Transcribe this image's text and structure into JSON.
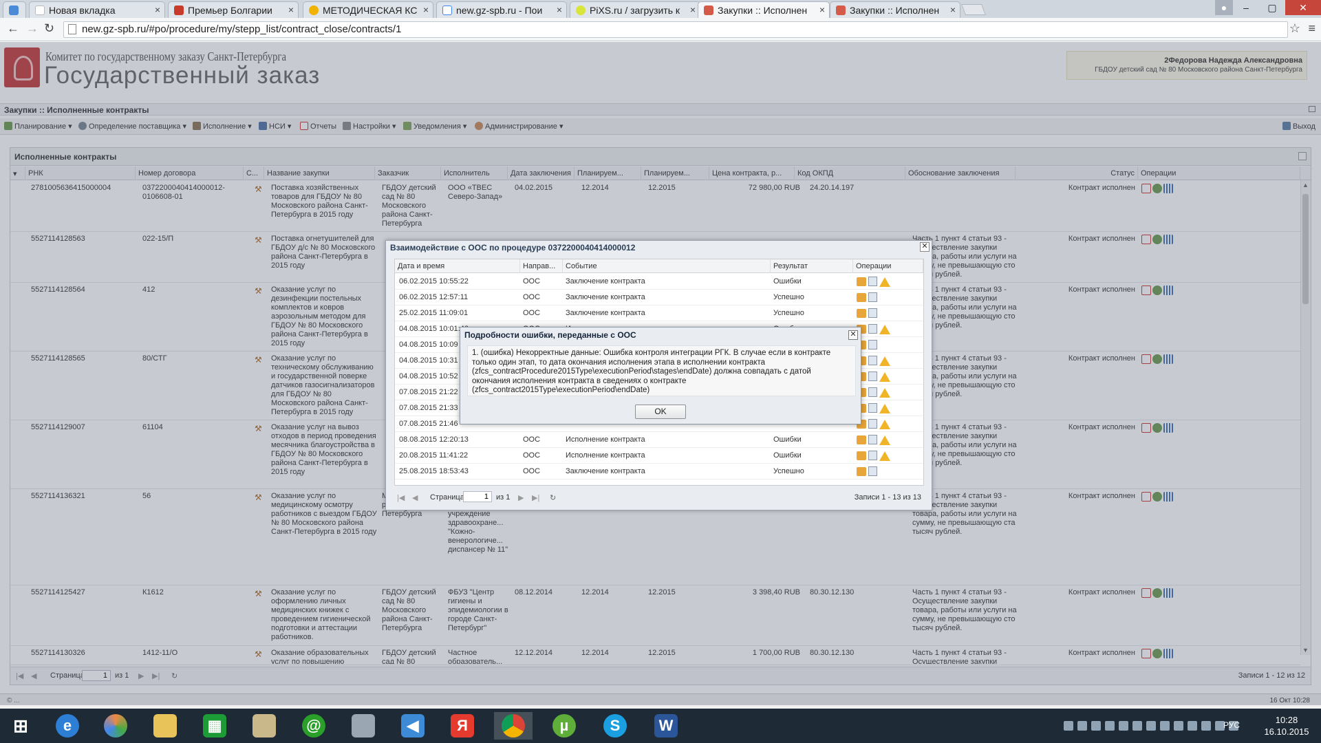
{
  "browser": {
    "tabs": [
      {
        "title": "",
        "close": ""
      },
      {
        "title": "Новая вкладка",
        "close": "×"
      },
      {
        "title": "Премьер Болгарии",
        "close": "×"
      },
      {
        "title": "МЕТОДИЧЕСКАЯ КС",
        "close": "×"
      },
      {
        "title": "new.gz-spb.ru - Пои",
        "close": "×"
      },
      {
        "title": "PiXS.ru / загрузить к",
        "close": "×"
      },
      {
        "title": "Закупки :: Исполнен",
        "close": "×"
      },
      {
        "title": "Закупки :: Исполнен",
        "close": "×"
      }
    ],
    "url": "new.gz-spb.ru/#po/procedure/my/stepp_list/contract_close/contracts/1"
  },
  "header": {
    "org_line1": "Комитет по государственному заказу Санкт-Петербурга",
    "org_line2": "Государственный заказ",
    "user_name": "2Федорова Надежда Александровна",
    "user_org": "ГБДОУ детский сад № 80 Московского района Санкт-Петербурга"
  },
  "breadcrumb": "Закупки :: Исполненные контракты",
  "toolbar": {
    "items": [
      "Планирование ▾",
      "Определение поставщика ▾",
      "Исполнение ▾",
      "НСИ ▾",
      "Отчеты",
      "Настройки ▾",
      "Уведомления ▾",
      "Администрирование ▾"
    ],
    "exit": "Выход"
  },
  "grid": {
    "title": "Исполненные контракты",
    "columns": [
      "РНК",
      "Номер договора",
      "С...",
      "Название закупки",
      "Заказчик",
      "Исполнитель",
      "Дата заключения",
      "Планируем...",
      "Планируем...",
      "Цена контракта, р...",
      "Код ОКПД",
      "Обоснование заключения",
      "Статус",
      "Операции"
    ],
    "rows": [
      {
        "rnk": "2781005636415000004",
        "num": "0372200040414000012-0106608-01",
        "name": "Поставка хозяйственных товаров для ГБДОУ № 80 Московского района Санкт-Петербурга в 2015 году",
        "customer": "ГБДОУ детский сад № 80 Московского района Санкт-Петербурга",
        "executor": "ООО «ТВЕС Северо-Запад»",
        "date": "04.02.2015",
        "plan1": "12.2014",
        "plan2": "12.2015",
        "price": "72 980,00 RUB",
        "okpd": "24.20.14.197",
        "reason": "",
        "status": "Контракт исполнен"
      },
      {
        "rnk": "5527114128563",
        "num": "022-15/П",
        "name": "Поставка огнетушителей для ГБДОУ д/с № 80 Московского района Санкт-Петербурга в 2015 году",
        "customer": "",
        "executor": "",
        "date": "",
        "plan1": "",
        "plan2": "",
        "price": "",
        "okpd": "",
        "reason": "Часть 1 пункт 4 статьи 93 - Осуществление закупки товара, работы или услуги на сумму, не превышающую сто тысяч рублей.",
        "status": "Контракт исполнен"
      },
      {
        "rnk": "5527114128564",
        "num": "412",
        "name": "Оказание услуг по дезинфекции постельных комплектов и ковров аэрозольным методом для ГБДОУ № 80 Московского района Санкт-Петербурга в 2015 году",
        "customer": "",
        "executor": "",
        "date": "",
        "plan1": "",
        "plan2": "",
        "price": "",
        "okpd": "",
        "reason": "Часть 1 пункт 4 статьи 93 - Осуществление закупки товара, работы или услуги на сумму, не превышающую сто тысяч рублей.",
        "status": "Контракт исполнен"
      },
      {
        "rnk": "5527114128565",
        "num": "80/СТГ",
        "name": "Оказание услуг по техническому обслуживанию и государственной поверке датчиков газосигнализаторов для ГБДОУ № 80 Московского района Санкт-Петербурга в 2015 году",
        "customer": "",
        "executor": "",
        "date": "",
        "plan1": "",
        "plan2": "",
        "price": "",
        "okpd": "",
        "reason": "Часть 1 пункт 4 статьи 93 - Осуществление закупки товара, работы или услуги на сумму, не превышающую сто тысяч рублей.",
        "status": "Контракт исполнен"
      },
      {
        "rnk": "5527114129007",
        "num": "61104",
        "name": "Оказание услуг на вывоз отходов в период проведения месячника благоустройства в ГБДОУ № 80 Московского района Санкт-Петербурга в 2015 году",
        "customer": "",
        "executor": "",
        "date": "",
        "plan1": "",
        "plan2": "",
        "price": "",
        "okpd": "",
        "reason": "Часть 1 пункт 4 статьи 93 - Осуществление закупки товара, работы или услуги на сумму, не превышающую сто тысяч рублей.",
        "status": "Контракт исполнен"
      },
      {
        "rnk": "5527114136321",
        "num": "56",
        "name": "Оказание услуг по медицинскому осмотру работников с выездом ГБДОУ № 80 Московского района Санкт-Петербурга в 2015 году",
        "customer": "Московского района Санкт-Петербурга",
        "executor": "государственное бюджетное учреждение здравоохране... \"Кожно-венерологиче... диспансер № 11\"",
        "date": "",
        "plan1": "",
        "plan2": "",
        "price": "",
        "okpd": "",
        "reason": "Часть 1 пункт 4 статьи 93 - Осуществление закупки товара, работы или услуги на сумму, не превышающую ста тысяч рублей.",
        "status": "Контракт исполнен"
      },
      {
        "rnk": "5527114125427",
        "num": "К1612",
        "name": "Оказание услуг по оформлению личных медицинских книжек с проведением гигиенической подготовки и аттестации работников.",
        "customer": "ГБДОУ детский сад № 80 Московского района Санкт-Петербурга",
        "executor": "ФБУЗ \"Центр гигиены и эпидемиологии в городе Санкт-Петербург\"",
        "date": "08.12.2014",
        "plan1": "12.2014",
        "plan2": "12.2015",
        "price": "3 398,40 RUB",
        "okpd": "80.30.12.130",
        "reason": "Часть 1 пункт 4 статьи 93 - Осуществление закупки товара, работы или услуги на сумму, не превышающую сто тысяч рублей.",
        "status": "Контракт исполнен"
      },
      {
        "rnk": "5527114130326",
        "num": "1412-11/О",
        "name": "Оказание образовательных услуг по повышению",
        "customer": "ГБДОУ детский сад № 80",
        "executor": "Частное образователь...",
        "date": "12.12.2014",
        "plan1": "12.2014",
        "plan2": "12.2015",
        "price": "1 700,00 RUB",
        "okpd": "80.30.12.130",
        "reason": "Часть 1 пункт 4 статьи 93 - Осуществление закупки",
        "status": "Контракт исполнен"
      }
    ],
    "pager": {
      "page_label": "Страница",
      "page": "1",
      "of": "из 1",
      "records": "Записи 1 - 12 из 12"
    }
  },
  "dialog_ooc": {
    "title": "Взаимодействие с ООС по процедуре 0372200040414000012",
    "columns": [
      "Дата и время",
      "Направ...",
      "Событие",
      "Результат",
      "Операции"
    ],
    "rows": [
      {
        "dt": "06.02.2015 10:55:22",
        "dir": "ООС",
        "event": "Заключение контракта",
        "result": "Ошибки",
        "warn": true
      },
      {
        "dt": "06.02.2015 12:57:11",
        "dir": "ООС",
        "event": "Заключение контракта",
        "result": "Успешно",
        "warn": false
      },
      {
        "dt": "25.02.2015 11:09:01",
        "dir": "ООС",
        "event": "Заключение контракта",
        "result": "Успешно",
        "warn": false
      },
      {
        "dt": "04.08.2015 10:01:46",
        "dir": "ООС",
        "event": "Исполнение контракта",
        "result": "Ошибки",
        "warn": true
      },
      {
        "dt": "04.08.2015 10:09",
        "dir": "",
        "event": "",
        "result": "",
        "warn": false
      },
      {
        "dt": "04.08.2015 10:31",
        "dir": "",
        "event": "",
        "result": "",
        "warn": true
      },
      {
        "dt": "04.08.2015 10:52",
        "dir": "",
        "event": "",
        "result": "",
        "warn": true
      },
      {
        "dt": "07.08.2015 21:22",
        "dir": "",
        "event": "",
        "result": "",
        "warn": true
      },
      {
        "dt": "07.08.2015 21:33",
        "dir": "",
        "event": "",
        "result": "",
        "warn": true
      },
      {
        "dt": "07.08.2015 21:46",
        "dir": "",
        "event": "",
        "result": "",
        "warn": true
      },
      {
        "dt": "08.08.2015 12:20:13",
        "dir": "ООС",
        "event": "Исполнение контракта",
        "result": "Ошибки",
        "warn": true
      },
      {
        "dt": "20.08.2015 11:41:22",
        "dir": "ООС",
        "event": "Исполнение контракта",
        "result": "Ошибки",
        "warn": true
      },
      {
        "dt": "25.08.2015 18:53:43",
        "dir": "ООС",
        "event": "Заключение контракта",
        "result": "Успешно",
        "warn": false
      }
    ],
    "pager": {
      "page_label": "Страница",
      "page": "1",
      "of": "из 1",
      "records": "Записи 1 - 13 из 13"
    }
  },
  "dialog_error": {
    "title": "Подробности ошибки, переданные с ООС",
    "message": "1. (ошибка) Некорректные данные: Ошибка контроля интеграции РГК. В случае если в контракте только один этап, то дата окончания исполнения этапа в исполнении контракта (zfcs_contractProcedure2015Type\\executionPeriod\\stages\\endDate) должна совпадать с датой окончания исполнения контракта в сведениях о контракте (zfcs_contract2015Type\\executionPeriod\\endDate)",
    "ok": "OK"
  },
  "statusbar": {
    "left": "© ...",
    "right": "16 Окт 10:28"
  },
  "taskbar": {
    "lang": "РУС",
    "time": "10:28",
    "date": "16.10.2015"
  }
}
